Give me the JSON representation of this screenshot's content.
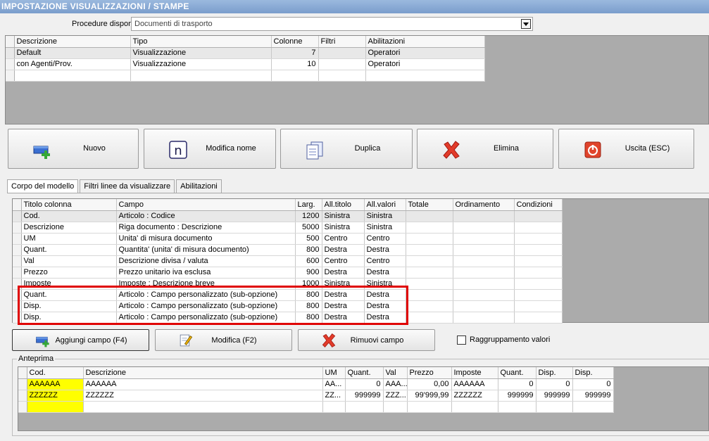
{
  "title": "IMPOSTAZIONE VISUALIZZAZIONI / STAMPE",
  "procedures": {
    "label": "Procedure disponibili :",
    "selected": "Documenti di trasporto"
  },
  "models": {
    "headers": [
      "Descrizione",
      "Tipo",
      "Colonne",
      "Filtri",
      "Abilitazioni"
    ],
    "rows": [
      [
        "Default",
        "Visualizzazione",
        "7",
        "",
        "Operatori"
      ],
      [
        "con Agenti/Prov.",
        "Visualizzazione",
        "10",
        "",
        "Operatori"
      ],
      [
        "",
        "",
        "",
        "",
        ""
      ]
    ]
  },
  "buttons": {
    "nuovo": "Nuovo",
    "modifica_nome": "Modifica nome",
    "duplica": "Duplica",
    "elimina": "Elimina",
    "uscita": "Uscita (ESC)",
    "aggiungi": "Aggiungi campo (F4)",
    "modifica": "Modifica (F2)",
    "rimuovi": "Rimuovi campo"
  },
  "tabs": [
    "Corpo del modello",
    "Filtri linee da visualizzare",
    "Abilitazioni"
  ],
  "columns": {
    "headers": [
      "Titolo colonna",
      "Campo",
      "Larg.",
      "All.titolo",
      "All.valori",
      "Totale",
      "Ordinamento",
      "Condizioni"
    ],
    "rows": [
      [
        "Cod.",
        "Articolo : Codice",
        "1200",
        "Sinistra",
        "Sinistra",
        "",
        "",
        ""
      ],
      [
        "Descrizione",
        "Riga documento : Descrizione",
        "5000",
        "Sinistra",
        "Sinistra",
        "",
        "",
        ""
      ],
      [
        "UM",
        "Unita' di misura documento",
        "500",
        "Centro",
        "Centro",
        "",
        "",
        ""
      ],
      [
        "Quant.",
        "Quantita' (unita' di misura documento)",
        "800",
        "Destra",
        "Destra",
        "",
        "",
        ""
      ],
      [
        "Val",
        "Descrizione divisa / valuta",
        "600",
        "Centro",
        "Centro",
        "",
        "",
        ""
      ],
      [
        "Prezzo",
        "Prezzo unitario iva esclusa",
        "900",
        "Destra",
        "Destra",
        "",
        "",
        ""
      ],
      [
        "Imposte",
        "Imposte : Descrizione breve",
        "1000",
        "Sinistra",
        "Sinistra",
        "",
        "",
        ""
      ],
      [
        "Quant.",
        "Articolo : Campo personalizzato (sub-opzione)",
        "800",
        "Destra",
        "Destra",
        "",
        "",
        ""
      ],
      [
        "Disp.",
        "Articolo : Campo personalizzato (sub-opzione)",
        "800",
        "Destra",
        "Destra",
        "",
        "",
        ""
      ],
      [
        "Disp.",
        "Articolo : Campo personalizzato (sub-opzione)",
        "800",
        "Destra",
        "Destra",
        "",
        "",
        ""
      ]
    ]
  },
  "grouping": {
    "label": "Raggruppamento valori"
  },
  "preview": {
    "legend": "Anteprima",
    "headers": [
      "Cod.",
      "Descrizione",
      "UM",
      "Quant.",
      "Val",
      "Prezzo",
      "Imposte",
      "Quant.",
      "Disp.",
      "Disp."
    ],
    "rows": [
      [
        "AAAAAA",
        "AAAAAA",
        "AA...",
        "0",
        "AAA...",
        "0,00",
        "AAAAAA",
        "0",
        "0",
        "0"
      ],
      [
        "ZZZZZZ",
        "ZZZZZZ",
        "ZZ...",
        "999999",
        "ZZZ...",
        "99'999,99",
        "ZZZZZZ",
        "999999",
        "999999",
        "999999"
      ],
      [
        "",
        "",
        "",
        "",
        "",
        "",
        "",
        "",
        "",
        ""
      ]
    ]
  },
  "colors": {
    "highlight": "#e00000",
    "code_cell": "#ffff00"
  }
}
